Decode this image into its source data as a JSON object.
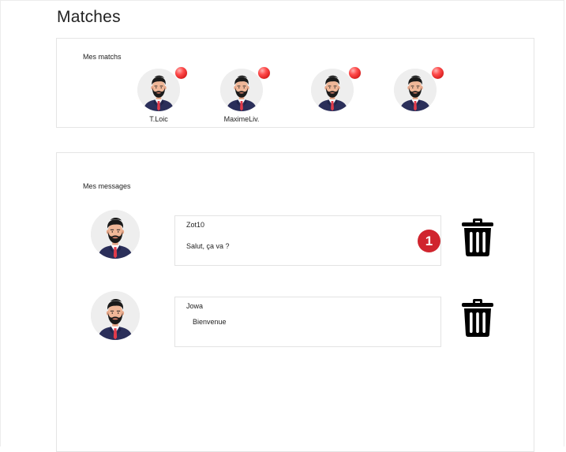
{
  "page": {
    "title": "Matches"
  },
  "matches_section": {
    "label": "Mes matchs",
    "status_color": "#e52222",
    "items": [
      {
        "name": "T.Loic"
      },
      {
        "name": "MaximeLiv."
      },
      {
        "name": ""
      },
      {
        "name": ""
      }
    ]
  },
  "messages_section": {
    "label": "Mes messages",
    "badge_color": "#d0252e",
    "items": [
      {
        "sender": "Zot10",
        "text": "Salut, ça va ?",
        "unread": "1",
        "delete_icon": "trash-icon"
      },
      {
        "sender": "Jowa",
        "text": "Bienvenue",
        "unread": "",
        "delete_icon": "trash-icon"
      }
    ]
  }
}
